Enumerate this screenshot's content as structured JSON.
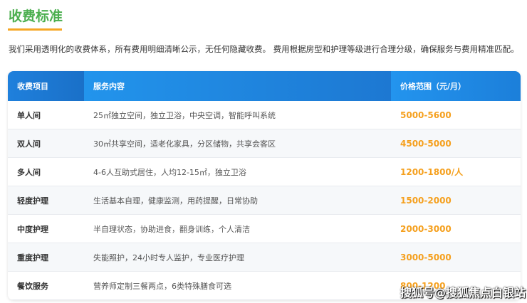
{
  "title": "收费标准",
  "intro": "我们采用透明化的收费体系，所有费用明细清晰公示，无任何隐藏收费。 费用根据房型和护理等级进行合理分级，确保服务与费用精准匹配。",
  "table": {
    "headers": [
      "收费项目",
      "服务内容",
      "价格范围（元/月）"
    ],
    "rows": [
      {
        "item": "单人间",
        "content": "25㎡独立空间，独立卫浴，中央空调，智能呼叫系统",
        "price": "5000-5600"
      },
      {
        "item": "双人间",
        "content": "30㎡共享空间，适老化家具，分区储物，共享会客区",
        "price": "4500-5000"
      },
      {
        "item": "多人间",
        "content": "4-6人互助式居住，人均12-15㎡，独立卫浴",
        "price": "1200-1800/人"
      },
      {
        "item": "轻度护理",
        "content": "生活基本自理，健康监测，用药提醒，日常协助",
        "price": "1500-2000"
      },
      {
        "item": "中度护理",
        "content": "半自理状态，协助进食，翻身训练，个人清洁",
        "price": "2000-3000"
      },
      {
        "item": "重度护理",
        "content": "失能照护，24小时专人监护，专业医疗护理",
        "price": "3000-5000"
      },
      {
        "item": "餐饮服务",
        "content": "营养师定制三餐两点，6类特殊膳食可选",
        "price": "800-1200"
      }
    ]
  },
  "watermark": "搜狐号@搜狐焦点白银站",
  "colors": {
    "title": "#4caf50",
    "accent": "#f5a623",
    "header": "#1e88e5"
  }
}
